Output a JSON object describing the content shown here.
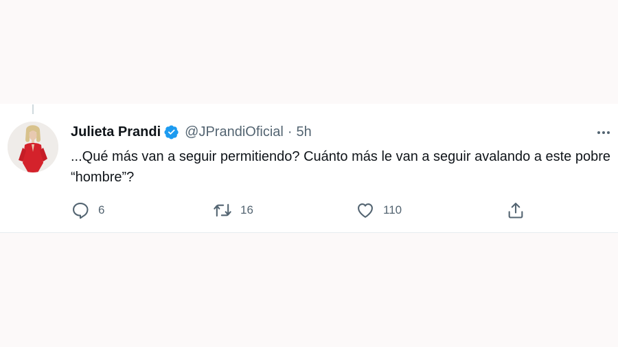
{
  "tweet": {
    "author_name": "Julieta Prandi",
    "handle": "@JPrandiOficial",
    "separator": "·",
    "time": "5h",
    "text": "...Qué más van a seguir permitiendo? Cuánto más le van a seguir avalando a este pobre “hombre”?",
    "verified": true,
    "accent_color": "#1d9bf0"
  },
  "actions": {
    "reply": {
      "icon": "reply-icon",
      "count": "6"
    },
    "retweet": {
      "icon": "retweet-icon",
      "count": "16"
    },
    "like": {
      "icon": "heart-icon",
      "count": "110"
    },
    "share": {
      "icon": "share-icon"
    }
  },
  "icons": {
    "more": "more-options-icon",
    "verified": "verified-badge-icon"
  }
}
